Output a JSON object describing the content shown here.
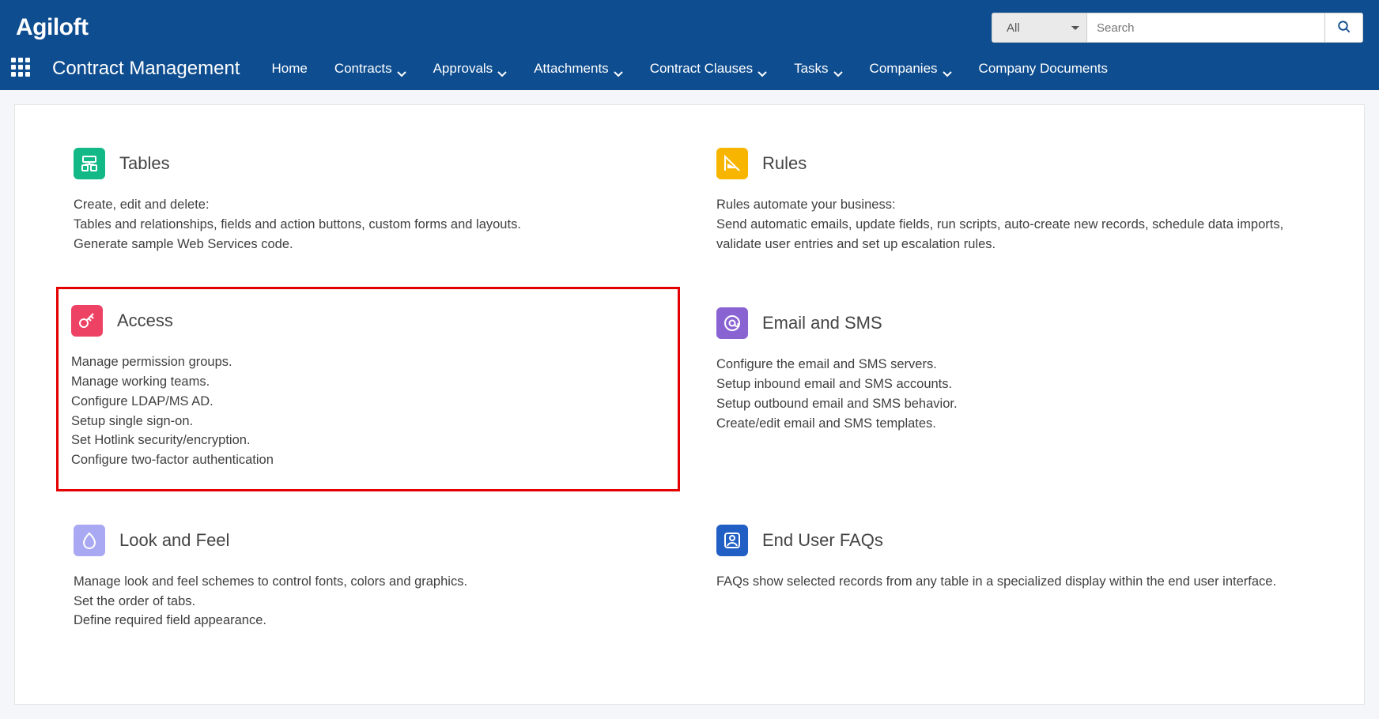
{
  "brand": "Agiloft",
  "module": "Contract Management",
  "search": {
    "filter_option": "All",
    "placeholder": "Search"
  },
  "nav": {
    "items": [
      {
        "label": "Home",
        "dropdown": false
      },
      {
        "label": "Contracts",
        "dropdown": true
      },
      {
        "label": "Approvals",
        "dropdown": true
      },
      {
        "label": "Attachments",
        "dropdown": true
      },
      {
        "label": "Contract Clauses",
        "dropdown": true
      },
      {
        "label": "Tasks",
        "dropdown": true
      },
      {
        "label": "Companies",
        "dropdown": true
      },
      {
        "label": "Company Documents",
        "dropdown": true
      }
    ]
  },
  "cards": {
    "tables": {
      "title": "Tables",
      "lines": [
        "Create, edit and delete:",
        "Tables and relationships, fields and action buttons, custom forms and layouts.",
        "Generate sample Web Services code."
      ]
    },
    "rules": {
      "title": "Rules",
      "lines": [
        "Rules automate your business:",
        "Send automatic emails, update fields, run scripts, auto-create new records, schedule data imports, validate user entries and set up escalation rules."
      ]
    },
    "access": {
      "title": "Access",
      "lines": [
        "Manage permission groups.",
        "Manage working teams.",
        "Configure LDAP/MS AD.",
        "Setup single sign-on.",
        "Set Hotlink security/encryption.",
        "Configure two-factor authentication"
      ]
    },
    "email": {
      "title": "Email and SMS",
      "lines": [
        "Configure the email and SMS servers.",
        "Setup inbound email and SMS accounts.",
        "Setup outbound email and SMS behavior.",
        "Create/edit email and SMS templates."
      ]
    },
    "look": {
      "title": "Look and Feel",
      "lines": [
        "Manage look and feel schemes to control fonts, colors and graphics.",
        "Set the order of tabs.",
        "Define required field appearance."
      ]
    },
    "faqs": {
      "title": "End User FAQs",
      "lines": [
        "FAQs show selected records from any table in a specialized display within the end user interface."
      ]
    }
  }
}
